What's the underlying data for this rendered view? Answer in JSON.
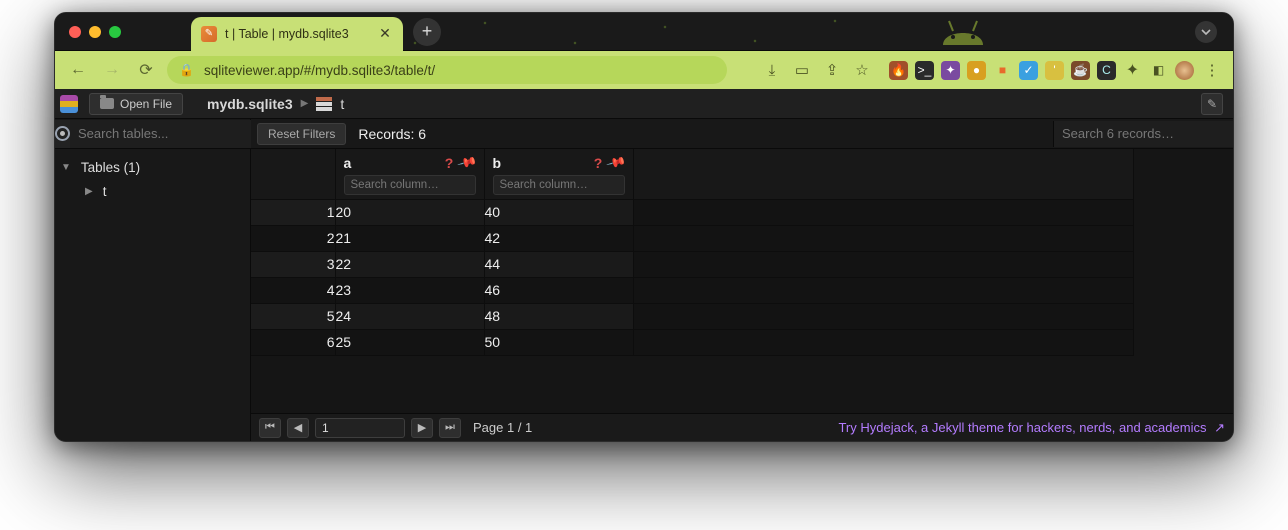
{
  "browser": {
    "tab_title": "t | Table | mydb.sqlite3",
    "url": "sqliteviewer.app/#/mydb.sqlite3/table/t/"
  },
  "header": {
    "open_file_label": "Open File",
    "db_name": "mydb.sqlite3",
    "table_name": "t"
  },
  "sidebar": {
    "search_placeholder": "Search tables...",
    "tables_heading": "Tables (1)",
    "items": [
      "t"
    ]
  },
  "toolbar": {
    "reset_label": "Reset Filters",
    "records_label": "Records: 6",
    "search_records_placeholder": "Search 6 records…"
  },
  "columns": [
    {
      "name": "a",
      "search_placeholder": "Search column…"
    },
    {
      "name": "b",
      "search_placeholder": "Search column…"
    }
  ],
  "rows": [
    {
      "n": "1",
      "a": "20",
      "b": "40"
    },
    {
      "n": "2",
      "a": "21",
      "b": "42"
    },
    {
      "n": "3",
      "a": "22",
      "b": "44"
    },
    {
      "n": "4",
      "a": "23",
      "b": "46"
    },
    {
      "n": "5",
      "a": "24",
      "b": "48"
    },
    {
      "n": "6",
      "a": "25",
      "b": "50"
    }
  ],
  "pager": {
    "current": "1",
    "label": "Page 1 / 1",
    "promo": "Try Hydejack, a Jekyll theme for hackers, nerds, and academics",
    "promo_arrow": "↗"
  }
}
